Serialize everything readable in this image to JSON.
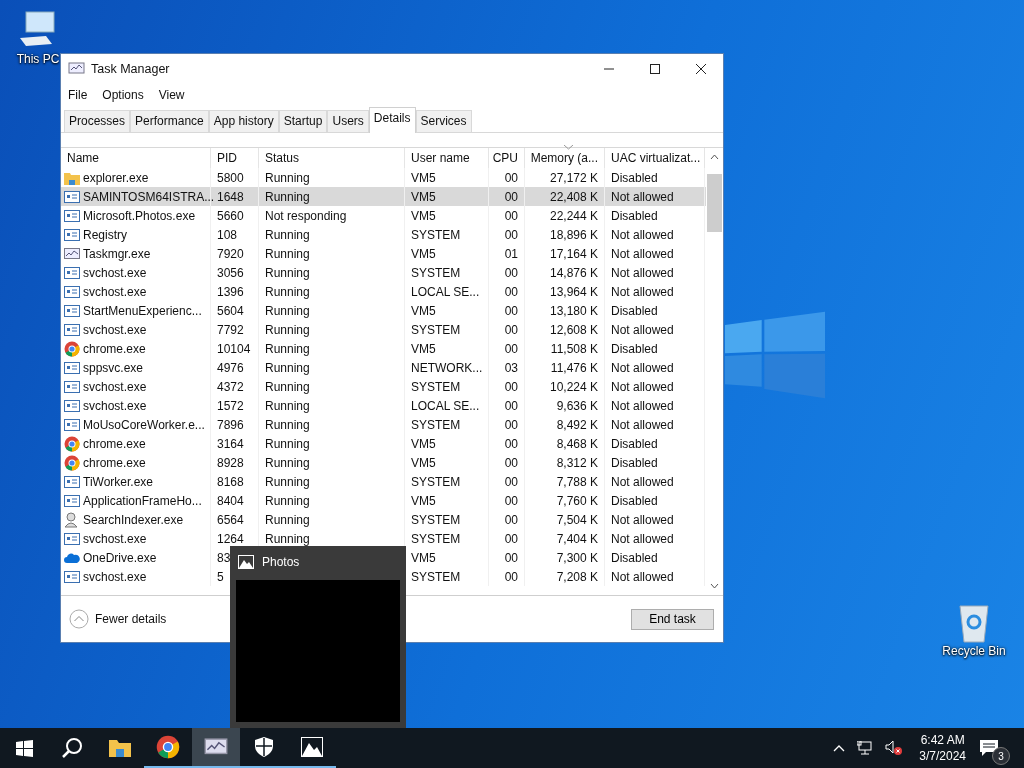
{
  "desktop_icons": [
    {
      "label": "This PC",
      "kind": "pc"
    },
    {
      "label": "Recycle Bin",
      "kind": "bin"
    }
  ],
  "window": {
    "title": "Task Manager"
  },
  "menu": [
    "File",
    "Options",
    "View"
  ],
  "tabs": [
    {
      "label": "Processes",
      "selected": false
    },
    {
      "label": "Performance",
      "selected": false
    },
    {
      "label": "App history",
      "selected": false
    },
    {
      "label": "Startup",
      "selected": false
    },
    {
      "label": "Users",
      "selected": false
    },
    {
      "label": "Details",
      "selected": true
    },
    {
      "label": "Services",
      "selected": false
    }
  ],
  "table": {
    "columns": [
      "Name",
      "PID",
      "Status",
      "User name",
      "CPU",
      "Memory (a...",
      "UAC virtualizat..."
    ],
    "rows": [
      {
        "kind": "folder",
        "name": "explorer.exe",
        "pid": "5800",
        "status": "Running",
        "user": "VM5",
        "cpu": "00",
        "memory": "27,172 K",
        "uac": "Disabled",
        "selected": false
      },
      {
        "kind": "app",
        "name": "SAMINTOSM64ISTRA...",
        "pid": "1648",
        "status": "Running",
        "user": "VM5",
        "cpu": "00",
        "memory": "22,408 K",
        "uac": "Not allowed",
        "selected": true
      },
      {
        "kind": "app",
        "name": "Microsoft.Photos.exe",
        "pid": "5660",
        "status": "Not responding",
        "user": "VM5",
        "cpu": "00",
        "memory": "22,244 K",
        "uac": "Disabled",
        "selected": false
      },
      {
        "kind": "app",
        "name": "Registry",
        "pid": "108",
        "status": "Running",
        "user": "SYSTEM",
        "cpu": "00",
        "memory": "18,896 K",
        "uac": "Not allowed",
        "selected": false
      },
      {
        "kind": "monitor",
        "name": "Taskmgr.exe",
        "pid": "7920",
        "status": "Running",
        "user": "VM5",
        "cpu": "01",
        "memory": "17,164 K",
        "uac": "Not allowed",
        "selected": false
      },
      {
        "kind": "app",
        "name": "svchost.exe",
        "pid": "3056",
        "status": "Running",
        "user": "SYSTEM",
        "cpu": "00",
        "memory": "14,876 K",
        "uac": "Not allowed",
        "selected": false
      },
      {
        "kind": "app",
        "name": "svchost.exe",
        "pid": "1396",
        "status": "Running",
        "user": "LOCAL SE...",
        "cpu": "00",
        "memory": "13,964 K",
        "uac": "Not allowed",
        "selected": false
      },
      {
        "kind": "app",
        "name": "StartMenuExperienc...",
        "pid": "5604",
        "status": "Running",
        "user": "VM5",
        "cpu": "00",
        "memory": "13,180 K",
        "uac": "Disabled",
        "selected": false
      },
      {
        "kind": "app",
        "name": "svchost.exe",
        "pid": "7792",
        "status": "Running",
        "user": "SYSTEM",
        "cpu": "00",
        "memory": "12,608 K",
        "uac": "Not allowed",
        "selected": false
      },
      {
        "kind": "chrome",
        "name": "chrome.exe",
        "pid": "10104",
        "status": "Running",
        "user": "VM5",
        "cpu": "00",
        "memory": "11,508 K",
        "uac": "Disabled",
        "selected": false
      },
      {
        "kind": "app",
        "name": "sppsvc.exe",
        "pid": "4976",
        "status": "Running",
        "user": "NETWORK...",
        "cpu": "03",
        "memory": "11,476 K",
        "uac": "Not allowed",
        "selected": false
      },
      {
        "kind": "app",
        "name": "svchost.exe",
        "pid": "4372",
        "status": "Running",
        "user": "SYSTEM",
        "cpu": "00",
        "memory": "10,224 K",
        "uac": "Not allowed",
        "selected": false
      },
      {
        "kind": "app",
        "name": "svchost.exe",
        "pid": "1572",
        "status": "Running",
        "user": "LOCAL SE...",
        "cpu": "00",
        "memory": "9,636 K",
        "uac": "Not allowed",
        "selected": false
      },
      {
        "kind": "app",
        "name": "MoUsoCoreWorker.e...",
        "pid": "7896",
        "status": "Running",
        "user": "SYSTEM",
        "cpu": "00",
        "memory": "8,492 K",
        "uac": "Not allowed",
        "selected": false
      },
      {
        "kind": "chrome",
        "name": "chrome.exe",
        "pid": "3164",
        "status": "Running",
        "user": "VM5",
        "cpu": "00",
        "memory": "8,468 K",
        "uac": "Disabled",
        "selected": false
      },
      {
        "kind": "chrome",
        "name": "chrome.exe",
        "pid": "8928",
        "status": "Running",
        "user": "VM5",
        "cpu": "00",
        "memory": "8,312 K",
        "uac": "Disabled",
        "selected": false
      },
      {
        "kind": "app",
        "name": "TiWorker.exe",
        "pid": "8168",
        "status": "Running",
        "user": "SYSTEM",
        "cpu": "00",
        "memory": "7,788 K",
        "uac": "Not allowed",
        "selected": false
      },
      {
        "kind": "app",
        "name": "ApplicationFrameHo...",
        "pid": "8404",
        "status": "Running",
        "user": "VM5",
        "cpu": "00",
        "memory": "7,760 K",
        "uac": "Disabled",
        "selected": false
      },
      {
        "kind": "user",
        "name": "SearchIndexer.exe",
        "pid": "6564",
        "status": "Running",
        "user": "SYSTEM",
        "cpu": "00",
        "memory": "7,504 K",
        "uac": "Not allowed",
        "selected": false
      },
      {
        "kind": "app",
        "name": "svchost.exe",
        "pid": "1264",
        "status": "Running",
        "user": "SYSTEM",
        "cpu": "00",
        "memory": "7,404 K",
        "uac": "Not allowed",
        "selected": false
      },
      {
        "kind": "cloud",
        "name": "OneDrive.exe",
        "pid": "83",
        "user": "VM5",
        "cpu": "00",
        "memory": "7,300 K",
        "uac": "Disabled",
        "selected": false
      },
      {
        "kind": "app",
        "name": "svchost.exe",
        "pid": "5",
        "user": "SYSTEM",
        "cpu": "00",
        "memory": "7,208 K",
        "uac": "Not allowed",
        "selected": false
      }
    ]
  },
  "footer": {
    "fewer_details": "Fewer details",
    "end_task": "End task"
  },
  "preview": {
    "title": "Photos"
  },
  "taskbar": {
    "apps": [
      {
        "kind": "start",
        "running": false,
        "selected": false
      },
      {
        "kind": "search",
        "running": false,
        "selected": false
      },
      {
        "kind": "folder",
        "running": false,
        "selected": false
      },
      {
        "kind": "chrome",
        "running": true,
        "selected": false
      },
      {
        "kind": "monitor",
        "running": true,
        "selected": true
      },
      {
        "kind": "shield",
        "running": true,
        "selected": false
      },
      {
        "kind": "photo",
        "running": true,
        "selected": false
      }
    ],
    "time": "6:42 AM",
    "date": "3/7/2024",
    "notifications": "3"
  }
}
